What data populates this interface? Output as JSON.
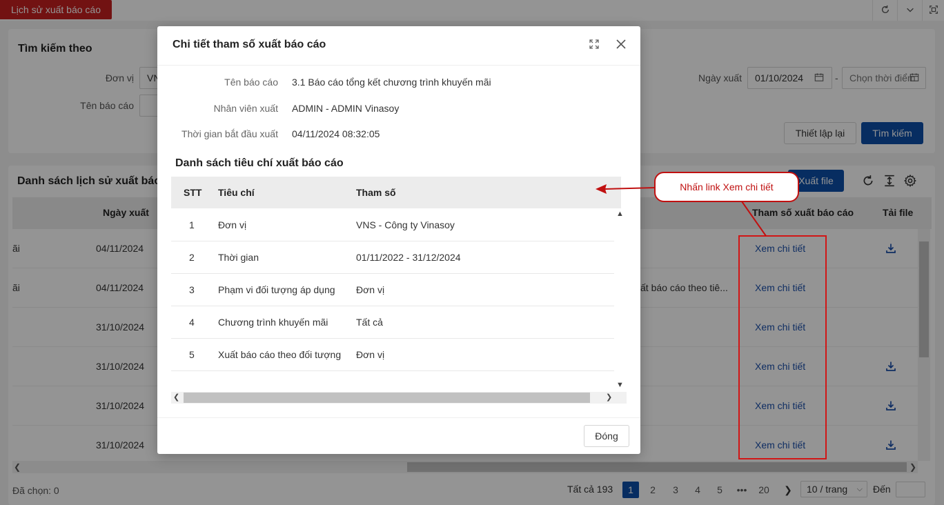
{
  "topbar": {
    "tab_label": "Lịch sử xuất báo cáo"
  },
  "search": {
    "title": "Tìm kiếm theo",
    "unit_label": "Đơn vị",
    "unit_value": "VN",
    "report_name_label": "Tên báo cáo",
    "export_date_label": "Ngày xuất",
    "date_from": "01/10/2024",
    "date_sep": "-",
    "date_to_placeholder": "Chọn thời điểm",
    "reset_label": "Thiết lập lại",
    "search_label": "Tìm kiếm"
  },
  "list": {
    "title": "Danh sách lịch sử xuất báo",
    "export_label": "Xuất file",
    "headers": {
      "date": "Ngày xuất",
      "params": "Tham số xuất báo cáo",
      "download": "Tải file"
    },
    "rows": [
      {
        "name": "ãi",
        "date": "04/11/2024",
        "extra": "",
        "link": "Xem chi tiết",
        "download": true
      },
      {
        "name": "ãi",
        "date": "04/11/2024",
        "extra": "ất báo cáo theo tiê...",
        "link": "Xem chi tiết",
        "download": false
      },
      {
        "name": "",
        "date": "31/10/2024",
        "extra": "",
        "link": "Xem chi tiết",
        "download": false
      },
      {
        "name": "",
        "date": "31/10/2024",
        "extra": "",
        "link": "Xem chi tiết",
        "download": true
      },
      {
        "name": "",
        "date": "31/10/2024",
        "extra": "",
        "link": "Xem chi tiết",
        "download": true
      },
      {
        "name": "",
        "date": "31/10/2024",
        "extra": "",
        "link": "Xem chi tiết",
        "download": true
      }
    ],
    "selected_text": "Đã chọn: 0",
    "total_text": "Tất cả 193",
    "pages": [
      "1",
      "2",
      "3",
      "4",
      "5",
      "•••",
      "20"
    ],
    "page_size": "10 / trang",
    "goto_label": "Đến"
  },
  "modal": {
    "title": "Chi tiết tham số xuất báo cáo",
    "fields": [
      {
        "label": "Tên báo cáo",
        "value": "3.1 Báo cáo tổng kết chương trình khuyến mãi"
      },
      {
        "label": "Nhân viên xuất",
        "value": "ADMIN - ADMIN Vinasoy"
      },
      {
        "label": "Thời gian bắt đầu xuất",
        "value": "04/11/2024 08:32:05"
      }
    ],
    "criteria_title": "Danh sách tiêu chí xuất báo cáo",
    "columns": {
      "stt": "STT",
      "criteria": "Tiêu chí",
      "param": "Tham số"
    },
    "criteria": [
      {
        "stt": "1",
        "criteria": "Đơn vị",
        "param": "VNS - Công ty Vinasoy"
      },
      {
        "stt": "2",
        "criteria": "Thời gian",
        "param": "01/11/2022 - 31/12/2024"
      },
      {
        "stt": "3",
        "criteria": "Phạm vi đối tượng áp dụng",
        "param": "Đơn vị"
      },
      {
        "stt": "4",
        "criteria": "Chương trình khuyến mãi",
        "param": "Tất cả"
      },
      {
        "stt": "5",
        "criteria": "Xuất báo cáo theo đối tượng",
        "param": "Đơn vị"
      }
    ],
    "close_label": "Đóng"
  },
  "annotation": {
    "callout_text": "Nhấn link Xem chi tiết"
  },
  "colors": {
    "brand_red": "#c51f1f",
    "primary_blue": "#0d4fa8",
    "link_blue": "#1a4faa",
    "annotation_red": "#c01010"
  }
}
